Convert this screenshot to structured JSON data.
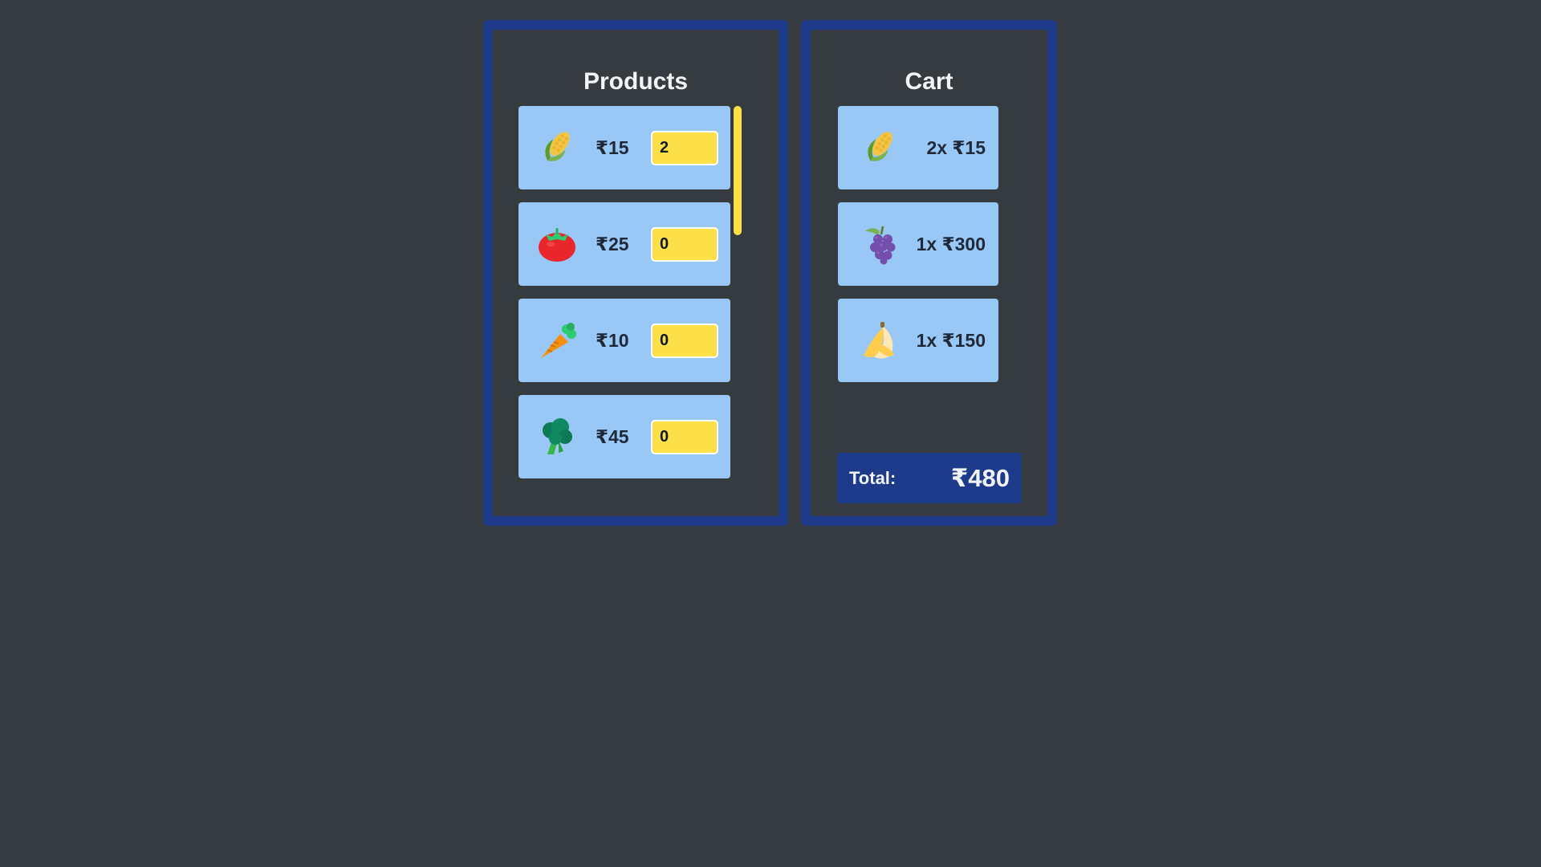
{
  "products": {
    "title": "Products",
    "items": [
      {
        "icon": "corn-icon",
        "price": "₹15",
        "quantity": "2"
      },
      {
        "icon": "tomato-icon",
        "price": "₹25",
        "quantity": "0"
      },
      {
        "icon": "carrot-icon",
        "price": "₹10",
        "quantity": "0"
      },
      {
        "icon": "broccoli-icon",
        "price": "₹45",
        "quantity": "0"
      }
    ]
  },
  "cart": {
    "title": "Cart",
    "items": [
      {
        "icon": "corn-icon",
        "line": "2x ₹15"
      },
      {
        "icon": "grapes-icon",
        "line": "1x ₹300"
      },
      {
        "icon": "banana-icon",
        "line": "1x ₹150"
      }
    ],
    "total_label": "Total:",
    "total_value": "₹480"
  },
  "colors": {
    "background": "#353b3e",
    "panel_border": "#1e3a8a",
    "card": "#99c7f6",
    "input": "#fde047",
    "scrollbar": "#fde047"
  }
}
